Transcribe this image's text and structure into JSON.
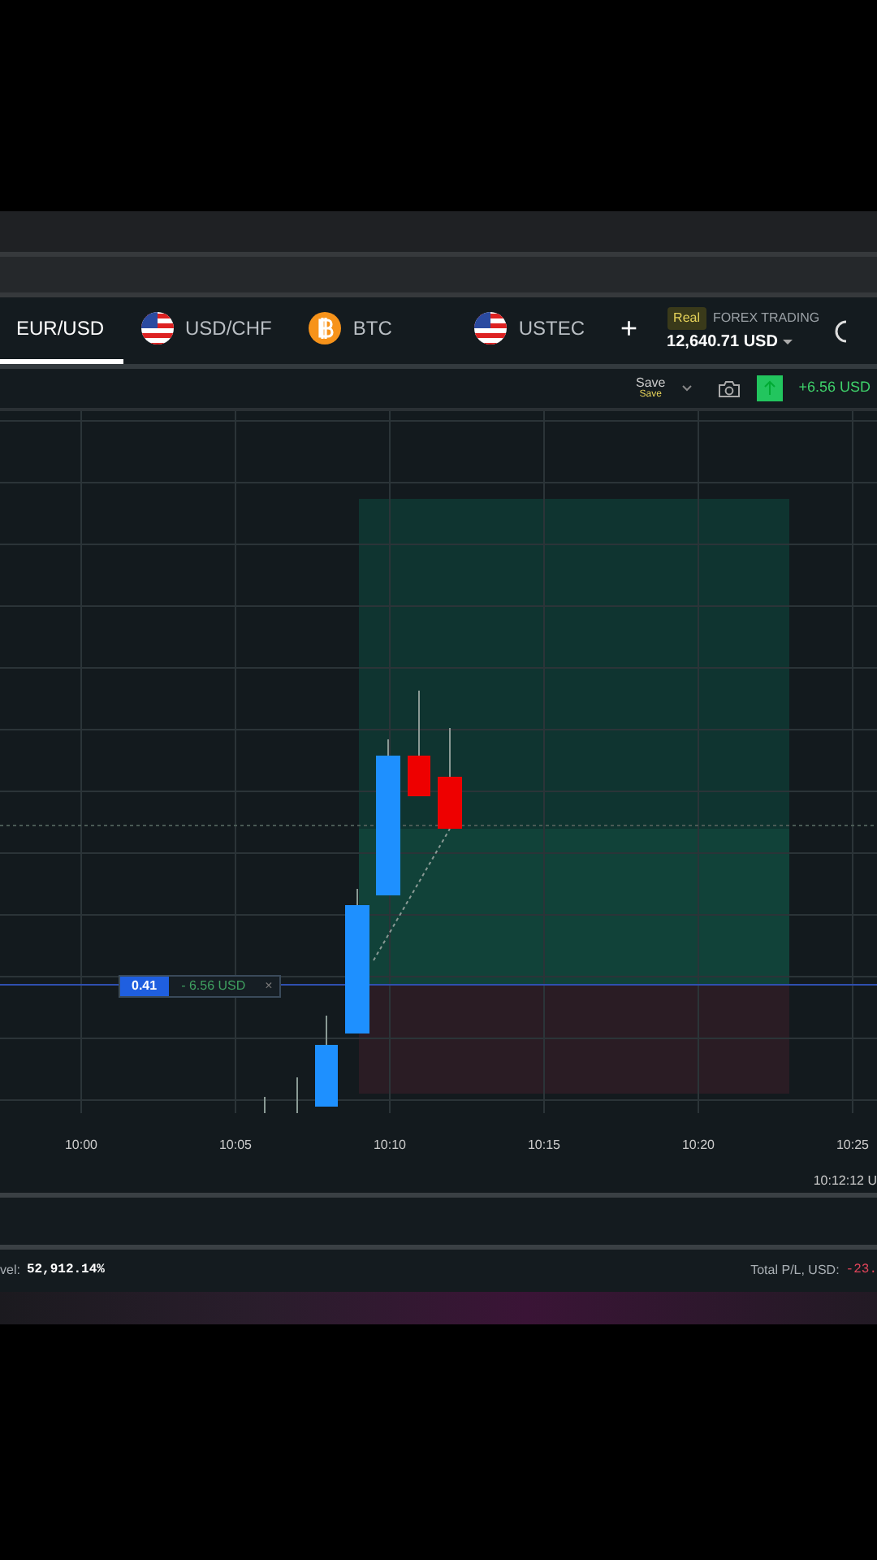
{
  "tabs": [
    {
      "label": "EUR/USD",
      "selected": true
    },
    {
      "label": "USD/CHF",
      "selected": false
    },
    {
      "label": "BTC",
      "selected": false
    },
    {
      "label": "USTEC",
      "selected": false
    }
  ],
  "add_tab": "+",
  "account": {
    "badge": "Real",
    "type": "FOREX TRADING",
    "balance": "12,640.71 USD"
  },
  "toolbar": {
    "save": "Save",
    "save_sub": "Save",
    "profit": "+6.56 USD"
  },
  "position": {
    "amount": "0.41",
    "pl": "- 6.56 USD",
    "close": "×"
  },
  "time_axis": [
    "10:00",
    "10:05",
    "10:10",
    "10:15",
    "10:20",
    "10:25"
  ],
  "server_time": "10:12:12 U",
  "footer": {
    "level_label": "vel:",
    "level": "52,912.14%",
    "pl_label": "Total P/L, USD:",
    "pl": "-23."
  }
}
